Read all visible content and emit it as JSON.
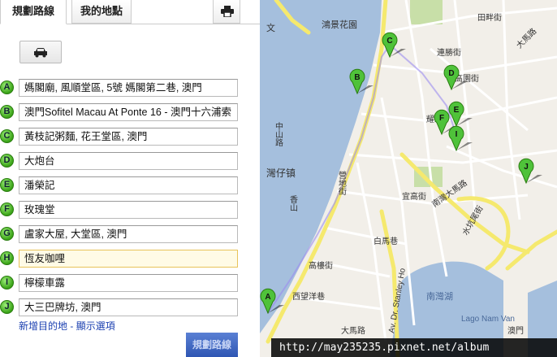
{
  "tabs": {
    "directions": "規劃路線",
    "my_places": "我的地點"
  },
  "print_icon": "printer-icon",
  "mode_icon": "car-icon",
  "stops": [
    {
      "letter": "A",
      "value": "媽閣廟, 風順堂區, 5號 媽閣第二巷, 澳門"
    },
    {
      "letter": "B",
      "value": "澳門Sofitel Macau At Ponte 16 - 澳門十六浦索"
    },
    {
      "letter": "C",
      "value": "黃枝記粥麵, 花王堂區, 澳門"
    },
    {
      "letter": "D",
      "value": "大炮台"
    },
    {
      "letter": "E",
      "value": "潘榮記"
    },
    {
      "letter": "F",
      "value": "玫瑰堂"
    },
    {
      "letter": "G",
      "value": "盧家大屋, 大堂區, 澳門"
    },
    {
      "letter": "H",
      "value": "恆友咖哩"
    },
    {
      "letter": "I",
      "value": "檸檬車露"
    },
    {
      "letter": "J",
      "value": "大三巴牌坊, 澳門"
    }
  ],
  "links": {
    "add_destination": "新增目的地",
    "separator": " - ",
    "show_options": "顯示選項"
  },
  "route_button": "規劃路線",
  "map": {
    "labels": {
      "wenyu": "文",
      "hongqiao_garden": "鴻景花園",
      "wanzai": "灣仔镇",
      "zhongshan_rd": "中山路",
      "xiangshan": "香山",
      "yingdi_st": "營地街",
      "yihua_st": "宜高街",
      "nanwan_ave": "南灣大馬路",
      "baiyan": "白馬巷",
      "gaolou_st": "高樓街",
      "ximang_st": "西望洋巷",
      "dabao_st": "大馬路",
      "stanley_ho": "Av. Dr. Stanley Ho",
      "nam_van_lake": "Lago Nam Van",
      "nam_van_cn": "南灣湖",
      "cotai": "澳門",
      "tianshen_st": "田畔街",
      "dama_st": "大馬路",
      "yaolu": "耀路",
      "lianzheng_st": "連勝街",
      "guihua_st": "高園街",
      "shuikeng": "水坑尾街"
    },
    "pins": [
      "A",
      "B",
      "C",
      "D",
      "E",
      "F",
      "I",
      "J"
    ]
  },
  "watermark": "http://may235235.pixnet.net/album"
}
